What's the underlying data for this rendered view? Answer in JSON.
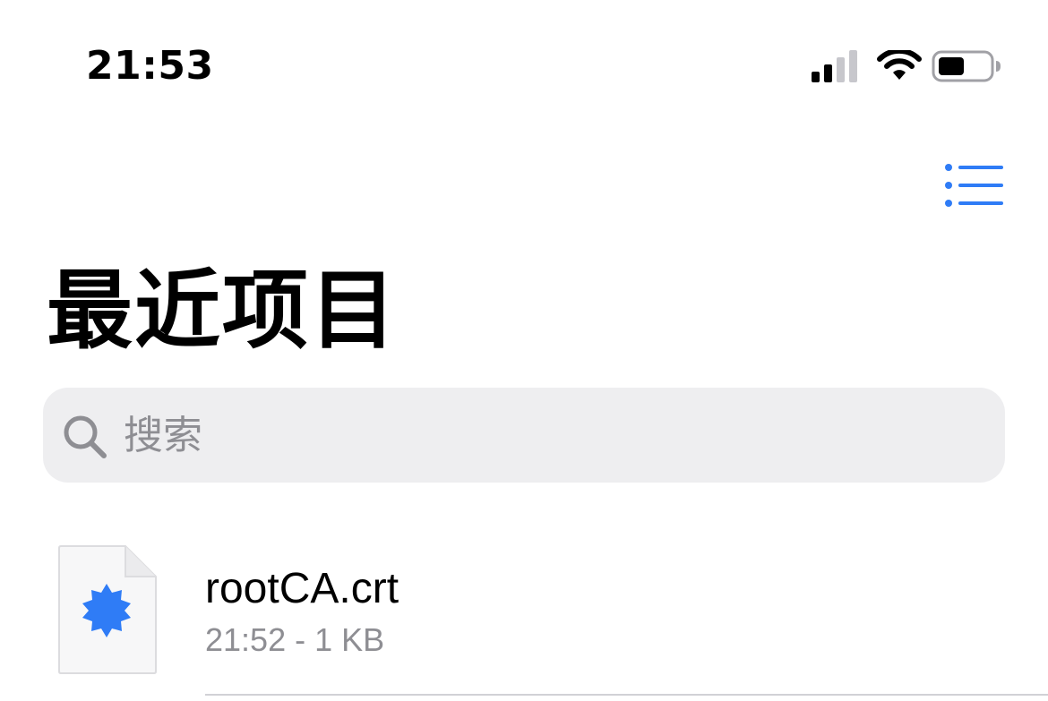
{
  "status_bar": {
    "time": "21:53",
    "icons": [
      "cellular-signal-icon",
      "wifi-icon",
      "battery-icon"
    ],
    "battery_level": 0.5
  },
  "nav": {
    "list_view_icon": "list-bullets-icon"
  },
  "page": {
    "title": "最近项目"
  },
  "search": {
    "placeholder": "搜索",
    "value": ""
  },
  "files": [
    {
      "name": "rootCA.crt",
      "meta": "21:52 - 1 KB",
      "icon": "certificate-file-icon"
    }
  ],
  "colors": {
    "accent": "#2f7cf6",
    "search_bg": "#eeeef0",
    "secondary_text": "#8e8e93",
    "separator": "#d1d1d6"
  }
}
